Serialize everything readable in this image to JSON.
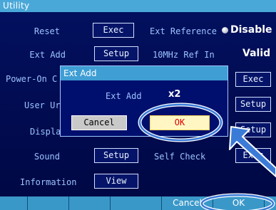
{
  "window": {
    "title": "Utility"
  },
  "settings": {
    "reset_label": "Reset",
    "reset_button": "Exec",
    "ext_reference_label": "Ext Reference",
    "ext_reference_value": "Disable",
    "ext_add_label": "Ext Add",
    "ext_add_button": "Setup",
    "ref_10mhz_label": "10MHz Ref In",
    "ref_10mhz_value": "Valid",
    "power_on_label": "Power-On C",
    "power_on_button": "Exec",
    "user_label": "User Ur",
    "user_button": "Setup",
    "display_label": "Displa",
    "display_button": "Setup",
    "sound_label": "Sound",
    "sound_button": "Setup",
    "self_check_label": "Self Check",
    "self_check_button": "Exec",
    "information_label": "Information",
    "information_button": "View"
  },
  "dialog": {
    "title": "Ext Add",
    "field_label": "Ext Add",
    "field_value": "x2",
    "cancel_label": "Cancel",
    "ok_label": "OK"
  },
  "softkeys": [
    "",
    "",
    "",
    "",
    "Cancel",
    "OK",
    ""
  ],
  "colors": {
    "background": "#000a55",
    "title_bar": "#4aa8d8",
    "ok_button_bg": "#fff6c4",
    "ok_button_text": "#e00000",
    "annotation": "#3b7bd8"
  }
}
